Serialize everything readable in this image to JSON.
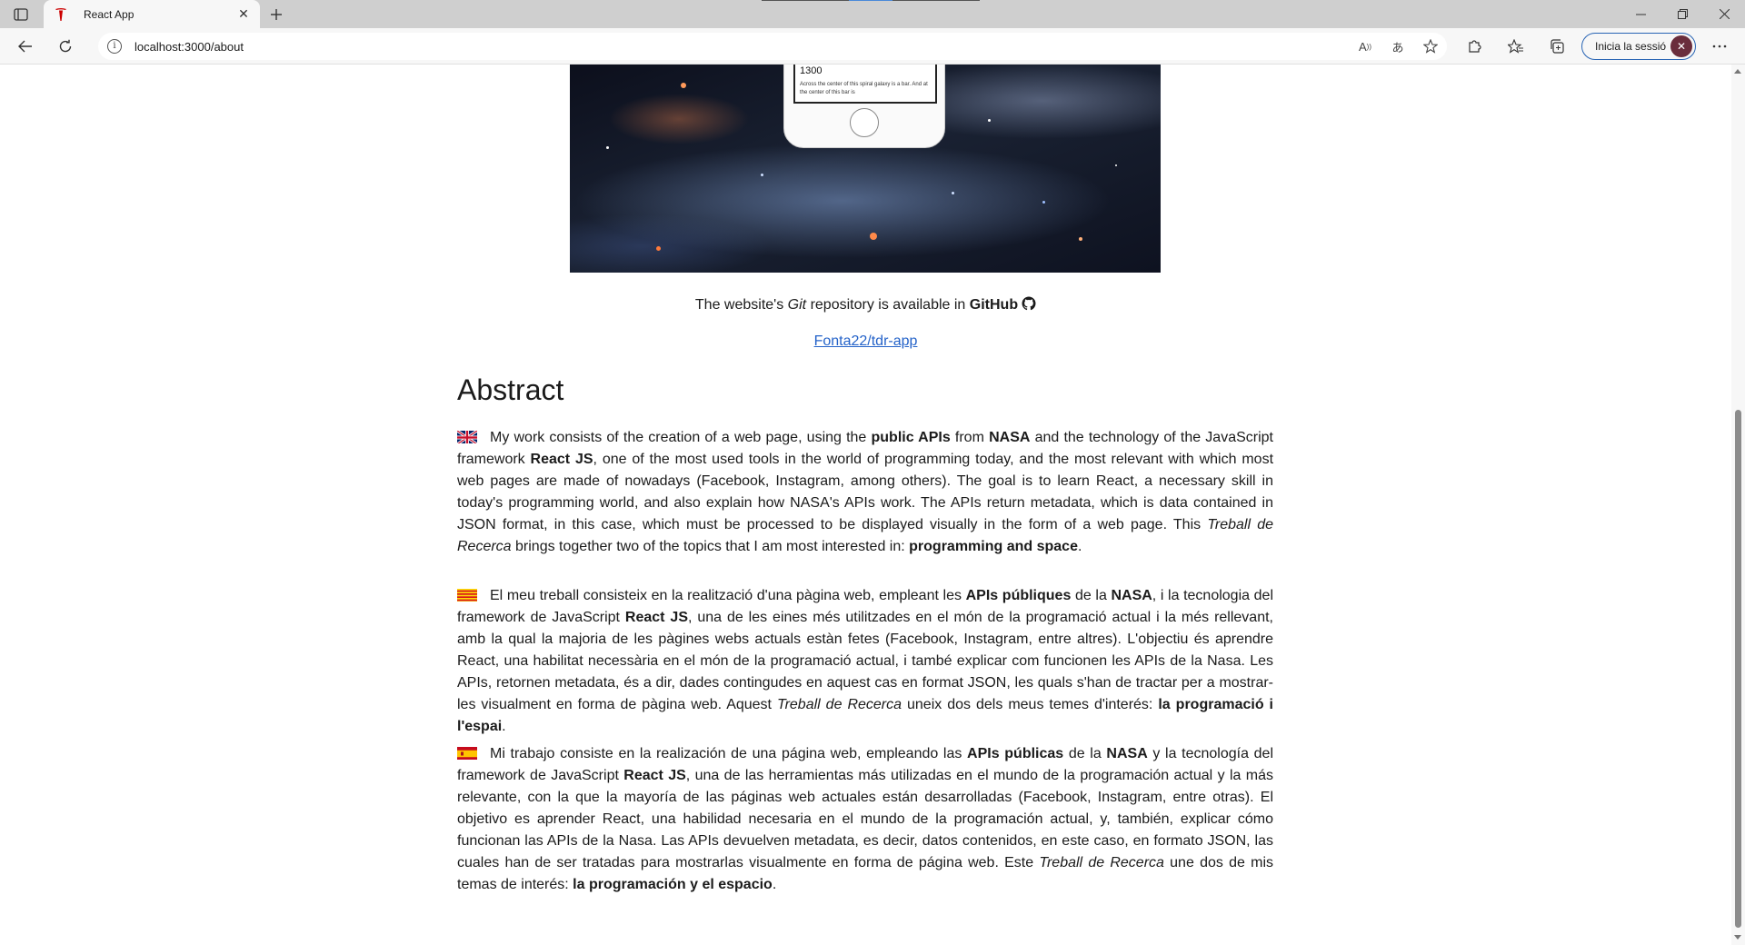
{
  "browser": {
    "tab_title": "React App",
    "url": "localhost:3000/about",
    "signin_label": "Inicia la sessió"
  },
  "hero": {
    "phone_number": "1300",
    "phone_text": "Across the center of this spiral galaxy is a bar. And at the center of this bar is"
  },
  "repo": {
    "text_before": "The website's ",
    "git_word": "Git",
    "text_middle": " repository is available in ",
    "github_word": "GitHub",
    "link_text": "Fonta22/tdr-app"
  },
  "abstract": {
    "title": "Abstract",
    "en": {
      "t1": "My work consists of the creation of a web page, using the ",
      "b1": "public APIs",
      "t2": " from ",
      "b2": "NASA",
      "t3": " and the technology of the JavaScript framework ",
      "b3": "React JS",
      "t4": ", one of the most used tools in the world of programming today, and the most relevant with which most web pages are made of nowadays (Facebook, Instagram, among others). The goal is to learn React, a necessary skill in today's programming world, and also explain how NASA's APIs work. The APIs return metadata, which is data contained in JSON format, in this case, which must be processed to be displayed visually in the form of a web page. This ",
      "i1": "Treball de Recerca",
      "t5": " brings together two of the topics that I am most interested in: ",
      "b4": "programming and space",
      "t6": "."
    },
    "ca": {
      "t1": "El meu treball consisteix en la realització d'una pàgina web, empleant les ",
      "b1": "APIs públiques",
      "t2": " de la ",
      "b2": "NASA",
      "t3": ", i la tecnologia del framework de JavaScript ",
      "b3": "React JS",
      "t4": ", una de les eines més utilitzades en el món de la programació actual i la més rellevant, amb la qual la majoria de les pàgines webs actuals estàn fetes (Facebook, Instagram, entre altres). L'objectiu és aprendre React, una habilitat necessària en el món de la programació actual, i també explicar com funcionen les APIs de la Nasa. Les APIs, retornen metadata, és a dir, dades contingudes en aquest cas en format JSON, les quals s'han de tractar per a mostrar-les visualment en forma de pàgina web. Aquest ",
      "i1": "Treball de Recerca",
      "t5": " uneix dos dels meus temes d'interés: ",
      "b4": "la programació i l'espai",
      "t6": "."
    },
    "es": {
      "t1": "Mi trabajo consiste en la realización de una página web, empleando las ",
      "b1": "APIs públicas",
      "t2": " de la ",
      "b2": "NASA",
      "t3": " y la tecnología del framework de JavaScript ",
      "b3": "React JS",
      "t4": ", una de las herramientas más utilizadas en el mundo de la programación actual y la más relevante, con la que la mayoría de las páginas web actuales están desarrolladas (Facebook, Instagram, entre otras). El objetivo es aprender React, una habilidad necesaria en el mundo de la programación actual, y, también, explicar cómo funcionan las APIs de la Nasa. Las APIs devuelven metadata, es decir, datos contenidos, en este caso, en formato JSON, las cuales han de ser tratadas para mostrarlas visualmente en forma de página web. Este ",
      "i1": "Treball de Recerca",
      "t5": " une dos de mis temas de interés: ",
      "b4": "la programación y el espacio",
      "t6": "."
    }
  },
  "colors": {
    "link": "#2563c9",
    "signin_border": "#2864b4",
    "tab_favicon": "#cc0000"
  },
  "icons": [
    "tab-actions-icon",
    "tesla-favicon-icon",
    "close-icon",
    "plus-icon",
    "minimize-icon",
    "restore-icon",
    "window-close-icon",
    "back-icon",
    "refresh-icon",
    "info-icon",
    "read-aloud-icon",
    "translate-icon",
    "add-favorite-icon",
    "extensions-icon",
    "favorites-icon",
    "collections-icon",
    "more-icon",
    "github-icon",
    "uk-flag-icon",
    "catalonia-flag-icon",
    "spain-flag-icon"
  ]
}
